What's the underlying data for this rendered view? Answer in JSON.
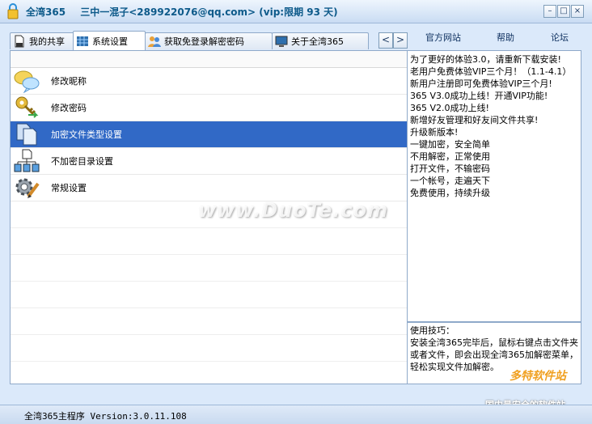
{
  "window": {
    "app_name": "全湾365",
    "user_info": "三中一混子<289922076@qq.com> (vip:限期 93 天)",
    "minimize": "–",
    "maximize": "□",
    "close": "×"
  },
  "tabs": [
    {
      "label": "我的共享"
    },
    {
      "label": "系统设置"
    },
    {
      "label": "获取免登录解密密码"
    },
    {
      "label": "关于全湾365"
    }
  ],
  "tab_nav": {
    "prev": "<",
    "next": ">"
  },
  "top_links": {
    "official_site": "官方网站",
    "help": "帮助",
    "forum": "论坛"
  },
  "settings_list": [
    {
      "label": "修改昵称"
    },
    {
      "label": "修改密码"
    },
    {
      "label": "加密文件类型设置"
    },
    {
      "label": "不加密目录设置"
    },
    {
      "label": "常规设置"
    }
  ],
  "news": [
    "为了更好的体验3.0，请重新下载安装!",
    "老用户免费体验VIP三个月！（1.1-4.1）",
    "新用户注册即可免费体验VIP三个月!",
    "365 V3.0成功上线！开通VIP功能!",
    "365 V2.0成功上线!",
    "新增好友管理和好友间文件共享!",
    "升级新版本!",
    "一键加密，安全简单",
    "不用解密，正常使用",
    "打开文件，不输密码",
    "一个帐号，走遍天下",
    "免费使用，持续升级"
  ],
  "tips": {
    "title": "使用技巧：",
    "body": "安装全湾365完毕后，鼠标右键点击文件夹或者文件，即会出现全湾365加解密菜单，轻松实现文件加解密。"
  },
  "status": {
    "text": "全湾365主程序 Version:3.0.11.108"
  },
  "watermark": {
    "text": "www.DuoTe.com",
    "logo_top": "多特软件站",
    "logo_bottom": "国内最安全的软件站"
  },
  "colors": {
    "selection": "#3169c6",
    "title_text": "#0d5a8a"
  }
}
